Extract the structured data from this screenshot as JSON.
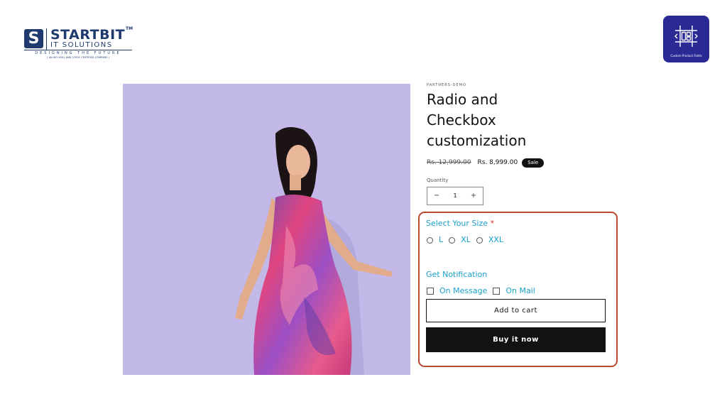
{
  "logo": {
    "mark": "S",
    "title": "STARTBIT",
    "tm": "TM",
    "subtitle": "IT SOLUTIONS",
    "tagline": "DESIGNING THE FUTURE",
    "certification": "( AN ISO 9001 AND 27001 CERTIFIED COMPANY )"
  },
  "app_badge": {
    "label": "Custom Product Fields",
    "icon": "grid-frame-icon"
  },
  "product": {
    "vendor": "PARTNERS-DEMO",
    "title": "Radio and Checkbox customization",
    "price_regular": "Rs. 12,999.00",
    "price_sale": "Rs. 8,999.00",
    "sale_badge": "Sale",
    "image_alt": "model-in-floral-dress"
  },
  "quantity": {
    "label": "Quantity",
    "value": "1",
    "minus": "−",
    "plus": "+"
  },
  "size_field": {
    "title": "Select Your Size",
    "required_mark": "*",
    "options": [
      "L",
      "XL",
      "XXL"
    ]
  },
  "notification_field": {
    "title": "Get Notification",
    "options": [
      "On Message",
      "On Mail"
    ]
  },
  "buttons": {
    "add_to_cart": "Add to cart",
    "buy_now": "Buy it now"
  },
  "colors": {
    "accent": "#1a9fc7",
    "highlight": "#b84a2e",
    "background_image": "#c2b9e8"
  }
}
